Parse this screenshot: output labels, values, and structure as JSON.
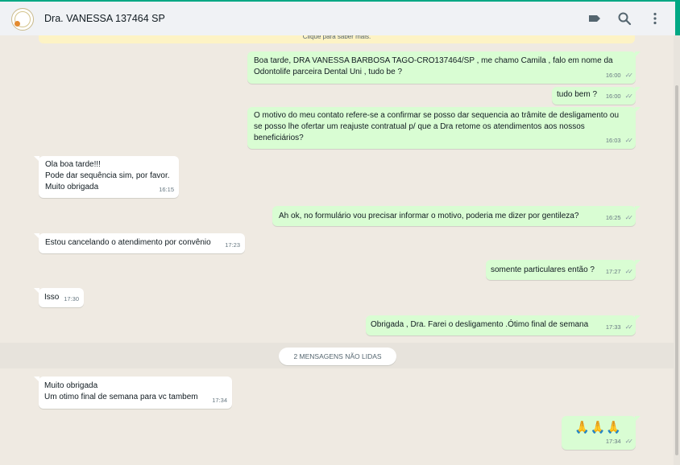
{
  "header": {
    "contact_name": "Dra. VANESSA 137464 SP",
    "icons": [
      "label-icon",
      "search-icon",
      "menu-icon"
    ]
  },
  "banner": {
    "text": "Clique para saber mais."
  },
  "messages": [
    {
      "dir": "out",
      "text": "Boa tarde, DRA VANESSA BARBOSA TAGO-CRO137464/SP , me chamo Camila , falo em nome da Odontolife parceira Dental Uni , tudo be ?",
      "time": "16:00"
    },
    {
      "dir": "out",
      "text": "tudo bem ?",
      "time": "16:00"
    },
    {
      "dir": "out",
      "text": "O motivo do meu contato refere-se a confirmar se posso dar sequencia ao trâmite de desligamento ou se posso lhe ofertar um reajuste contratual p/ que a Dra retome os atendimentos aos nossos beneficiários?",
      "time": "16:03"
    },
    {
      "dir": "in",
      "text": "Ola boa tarde!!!\nPode dar sequência sim, por favor.\nMuito obrigada",
      "time": "16:15"
    },
    {
      "dir": "out",
      "text": "Ah ok, no formulário vou precisar informar o motivo, poderia me dizer por gentileza?",
      "time": "16:25"
    },
    {
      "dir": "in",
      "text": "Estou cancelando o atendimento por convênio",
      "time": "17:23"
    },
    {
      "dir": "out",
      "text": "somente particulares então ?",
      "time": "17:27"
    },
    {
      "dir": "in",
      "text": "Isso",
      "time": "17:30"
    },
    {
      "dir": "out",
      "text": "Obrigada , Dra. Farei o desligamento .Ótimo final de semana",
      "time": "17:33"
    },
    {
      "dir": "in",
      "text": "Muito obrigada\nUm otimo final de semana para vc tambem",
      "time": "17:34"
    },
    {
      "dir": "out",
      "text": "🙏🙏🙏",
      "time": "17:34"
    }
  ],
  "unread_divider": "2 MENSAGENS NÃO LIDAS",
  "colors": {
    "accent": "#00a884",
    "outgoing_bubble": "#d9fdd3",
    "incoming_bubble": "#ffffff",
    "chat_bg": "#efeae2"
  }
}
